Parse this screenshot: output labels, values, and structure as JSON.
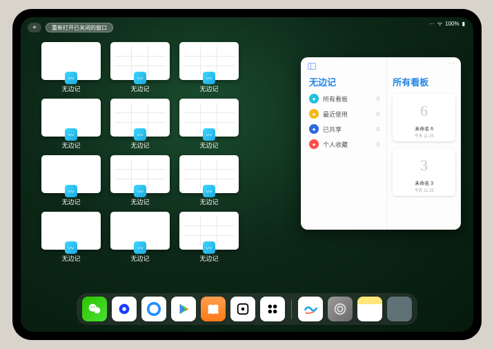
{
  "status": {
    "signal": "᯾",
    "wifi": "ᯤ",
    "battery": "100%"
  },
  "top": {
    "plus": "+",
    "reopen_label": "重新打开已关闭的窗口"
  },
  "app": {
    "name": "无边记"
  },
  "windows": [
    {
      "label": "无边记",
      "variant": "blank"
    },
    {
      "label": "无边记",
      "variant": "grid"
    },
    {
      "label": "无边记",
      "variant": "grid"
    },
    {
      "label": "无边记",
      "variant": "blank"
    },
    {
      "label": "无边记",
      "variant": "grid"
    },
    {
      "label": "无边记",
      "variant": "grid"
    },
    {
      "label": "无边记",
      "variant": "blank"
    },
    {
      "label": "无边记",
      "variant": "grid"
    },
    {
      "label": "无边记",
      "variant": "grid"
    },
    {
      "label": "无边记",
      "variant": "blank"
    },
    {
      "label": "无边记",
      "variant": "blank"
    },
    {
      "label": "无边记",
      "variant": "grid"
    }
  ],
  "popup": {
    "sidebar_title": "无边记",
    "right_title": "所有看板",
    "items": [
      {
        "label": "所有看板",
        "count": "0",
        "color": "c1"
      },
      {
        "label": "最近使用",
        "count": "0",
        "color": "c2"
      },
      {
        "label": "已共享",
        "count": "0",
        "color": "c3"
      },
      {
        "label": "个人收藏",
        "count": "0",
        "color": "c4"
      }
    ],
    "boards": [
      {
        "name": "未命名 6",
        "date": "今天 11:25",
        "glyph": "6"
      },
      {
        "name": "未命名 3",
        "date": "今天 11:25",
        "glyph": "3"
      }
    ]
  },
  "dock": {
    "apps": [
      "wechat",
      "quark",
      "qq",
      "play",
      "books",
      "dice",
      "mix"
    ],
    "recent": [
      "freeform",
      "settings",
      "notes",
      "library"
    ]
  }
}
